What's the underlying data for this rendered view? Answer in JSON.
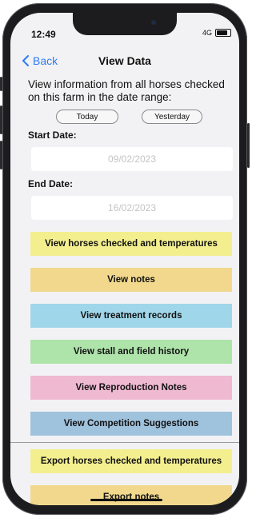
{
  "status": {
    "time": "12:49",
    "network": "4G"
  },
  "nav": {
    "back_label": "Back",
    "title": "View Data"
  },
  "intro": {
    "text": "View information from all horses checked on this farm in the date range:"
  },
  "quick": {
    "today_label": "Today",
    "yesterday_label": "Yesterday"
  },
  "dates": {
    "start_label": "Start Date:",
    "start_value": "09/02/2023",
    "end_label": "End Date:",
    "end_value": "16/02/2023"
  },
  "actions": [
    {
      "label": "View horses checked and temperatures",
      "color": "#f3ef8e"
    },
    {
      "label": "View notes",
      "color": "#f1d88c"
    },
    {
      "label": "View treatment records",
      "color": "#9fd6ea"
    },
    {
      "label": "View stall and field history",
      "color": "#aee3aa"
    },
    {
      "label": "View Reproduction Notes",
      "color": "#efb9d2"
    },
    {
      "label": "View Competition Suggestions",
      "color": "#9fc2dd"
    },
    {
      "label": "Export horses checked and temperatures",
      "color": "#f3ef8e"
    },
    {
      "label": "Export notes",
      "color": "#f1d88c"
    }
  ]
}
